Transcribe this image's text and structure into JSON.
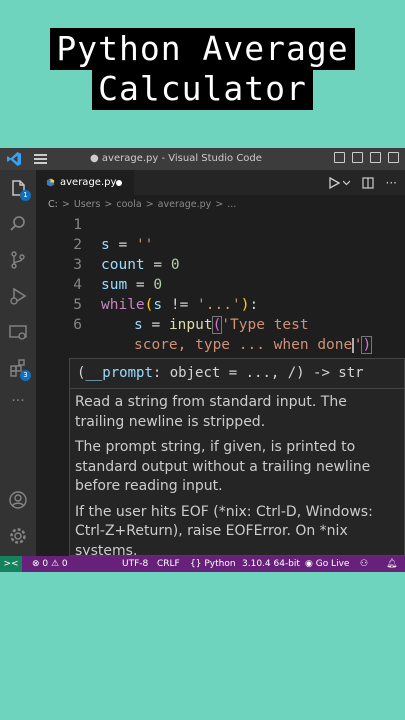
{
  "banner": {
    "line1": "Python Average",
    "line2": "Calculator"
  },
  "window": {
    "title": "● average.py - Visual Studio Code"
  },
  "activitybar": {
    "explorer_badge": "1",
    "extensions_badge": "3"
  },
  "tab": {
    "label": "average.py"
  },
  "breadcrumb": [
    "C:",
    ">",
    "Users",
    ">",
    "coola",
    ">",
    "average.py",
    ">",
    "..."
  ],
  "editor": {
    "line_numbers": [
      "1",
      "2",
      "3",
      "4",
      "5",
      "6"
    ],
    "lines": {
      "l2_var": "s",
      "l2_op": " = ",
      "l2_val": "''",
      "l3_var": "count",
      "l3_op": " = ",
      "l3_val": "0",
      "l4_var": "sum",
      "l4_op": " = ",
      "l4_val": "0",
      "l5_kw": "while",
      "l5_open": "(",
      "l5_var": "s",
      "l5_op": " != ",
      "l5_val": "'...'",
      "l5_close": ")",
      "l5_colon": ":",
      "l6_var": "s",
      "l6_op": " = ",
      "l6_fn": "input",
      "l6_open": "(",
      "l6_str": "'Type test",
      "l6b_str": "score, type ... when done",
      "l6b_quote": "'",
      "l6b_close": ")"
    }
  },
  "hover": {
    "signature_open": "(",
    "signature_param": "__prompt",
    "signature_rest": ": object = ..., /) -> str",
    "doc1": "Read a string from standard input. The trailing newline is stripped.",
    "doc2": "The prompt string, if given, is printed to standard output without a trailing newline before reading input.",
    "doc3": "If the user hits EOF (*nix: Ctrl-D, Windows: Ctrl-Z+Return), raise EOFError. On *nix systems,"
  },
  "statusbar": {
    "remote": "><",
    "errors": "⊗ 0 ⚠ 0",
    "encoding": "UTF-8",
    "eol": "CRLF",
    "language": "Python",
    "interpreter": "3.10.4 64-bit",
    "golive": "Go Live"
  },
  "colors": {
    "background": "#6fd4bd",
    "editor_bg": "#1e1e1e",
    "statusbar": "#68217a",
    "accent": "#0e70c0"
  }
}
